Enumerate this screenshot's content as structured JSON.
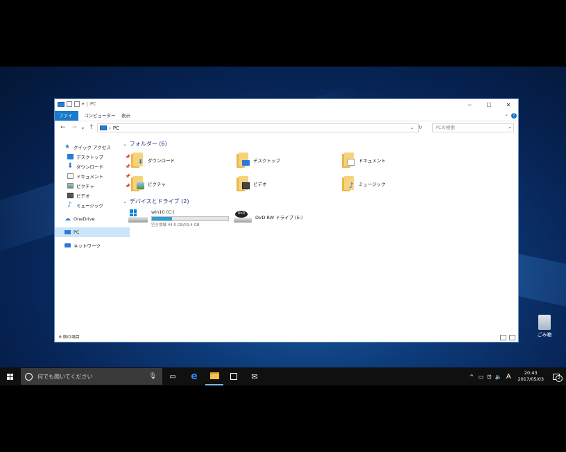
{
  "window": {
    "title": "PC",
    "ribbon_tabs": [
      "ファイル",
      "コンピューター",
      "表示"
    ],
    "address": "PC",
    "search_placeholder": "PCの検索",
    "status": "6 個の項目"
  },
  "sidebar": {
    "items": [
      {
        "label": "クイック アクセス",
        "icon": "star-icon",
        "pinned": false
      },
      {
        "label": "デスクトップ",
        "icon": "desktop-icon",
        "pinned": true
      },
      {
        "label": "ダウンロード",
        "icon": "download-icon",
        "pinned": true
      },
      {
        "label": "ドキュメント",
        "icon": "document-icon",
        "pinned": true
      },
      {
        "label": "ピクチャ",
        "icon": "picture-icon",
        "pinned": true
      },
      {
        "label": "ビデオ",
        "icon": "video-icon",
        "pinned": false
      },
      {
        "label": "ミュージック",
        "icon": "music-icon",
        "pinned": false
      },
      {
        "label": "OneDrive",
        "icon": "onedrive-icon",
        "pinned": false
      },
      {
        "label": "PC",
        "icon": "pc-icon",
        "pinned": false,
        "selected": true
      },
      {
        "label": "ネットワーク",
        "icon": "network-icon",
        "pinned": false
      }
    ]
  },
  "folders_group": {
    "header": "フォルダー (6)",
    "items": [
      {
        "label": "ダウンロード",
        "icon": "download-icon"
      },
      {
        "label": "デスクトップ",
        "icon": "desktop-icon"
      },
      {
        "label": "ドキュメント",
        "icon": "document-icon"
      },
      {
        "label": "ピクチャ",
        "icon": "picture-icon"
      },
      {
        "label": "ビデオ",
        "icon": "video-icon"
      },
      {
        "label": "ミュージック",
        "icon": "music-icon"
      }
    ]
  },
  "drives_group": {
    "header": "デバイスとドライブ (2)",
    "items": [
      {
        "label": "win10 (C:)",
        "free": "空き領域 44.0 GB/59.4 GB",
        "used_fraction": 0.26,
        "icon": "windows-drive-icon"
      },
      {
        "label": "DVD RW ドライブ (E:)",
        "icon": "dvd-drive-icon"
      }
    ]
  },
  "desktop": {
    "recycle_bin_label": "ごみ箱"
  },
  "taskbar": {
    "search_placeholder": "何でも聞いてください",
    "time": "20:43",
    "date": "2017/05/03",
    "ime": "A",
    "notification_count": "2"
  },
  "colors": {
    "accent": "#1979ca",
    "selection": "#cce4f7",
    "folder_header": "#1e3287",
    "drive_bar": "#26a0da",
    "taskbar": "#101010"
  }
}
